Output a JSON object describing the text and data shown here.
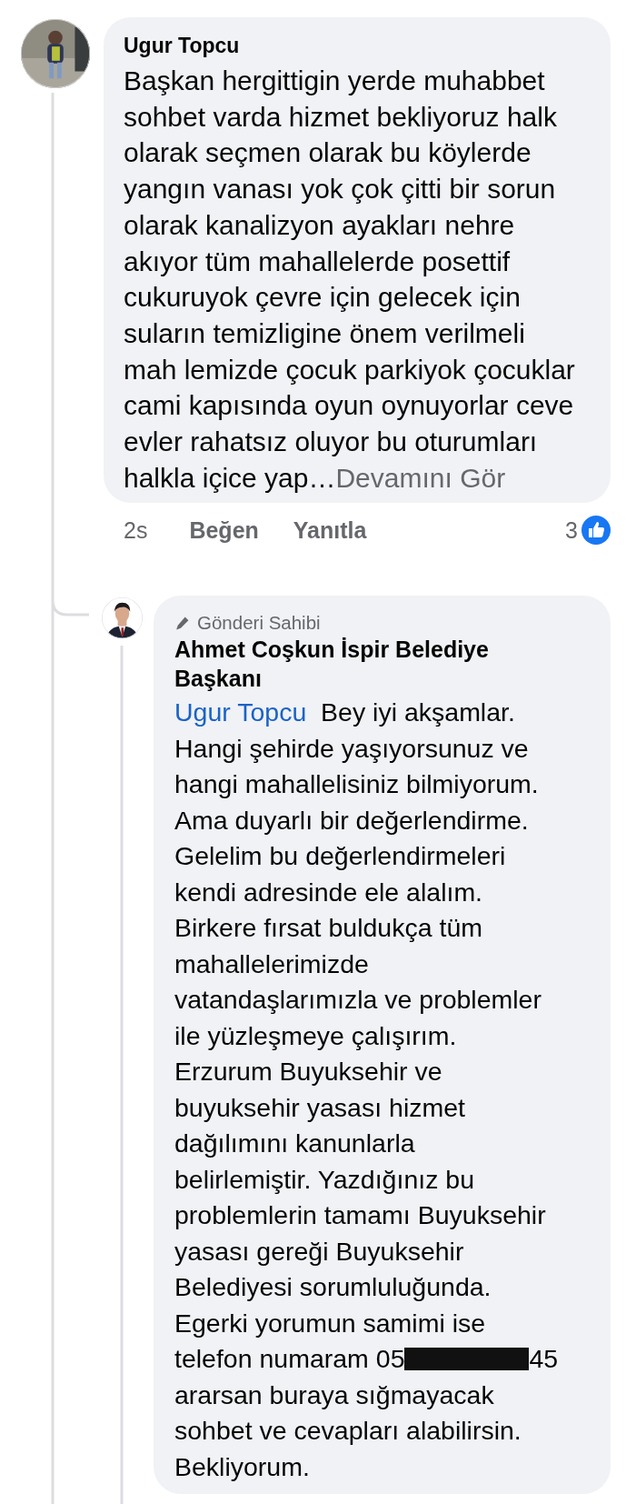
{
  "comment": {
    "author": "Ugur Topcu",
    "lines": [
      "Başkan hergittigin yerde muhabbet",
      "sohbet varda hizmet bekliyoruz halk",
      "olarak seçmen olarak bu köylerde",
      "yangın vanası yok çok çitti bir sorun",
      "olarak kanalizyon ayakları nehre",
      "akıyor tüm mahallelerde posettif",
      "cukuruyok çevre için gelecek için",
      "suların temizligine önem verilmeli",
      "mah lemizde çocuk parkiyok çocuklar",
      "cami kapısında oyun oynuyorlar ceve",
      "evler rahatsız oluyor bu oturumları",
      "halkla içice yap…"
    ],
    "see_more": "Devamını Gör",
    "time": "2s",
    "like_label": "Beğen",
    "reply_label": "Yanıtla",
    "reaction_count": "3"
  },
  "reply": {
    "badge": "Gönderi Sahibi",
    "author": "Ahmet Coşkun İspir Belediye Başkanı",
    "mention": "Ugur Topcu",
    "lines": [
      {
        "kind": "mention",
        "text": "Bey iyi akşamlar."
      },
      {
        "kind": "text",
        "text": "Hangi şehirde yaşıyorsunuz ve"
      },
      {
        "kind": "text",
        "text": "hangi mahallelisiniz bilmiyorum."
      },
      {
        "kind": "text",
        "text": "Ama duyarlı bir değerlendirme."
      },
      {
        "kind": "text",
        "text": "Gelelim bu değerlendirmeleri"
      },
      {
        "kind": "text",
        "text": "kendi adresinde ele alalım."
      },
      {
        "kind": "text",
        "text": "Birkere fırsat buldukça tüm"
      },
      {
        "kind": "text",
        "text": "mahallelerimizde"
      },
      {
        "kind": "text",
        "text": "vatandaşlarımızla ve problemler"
      },
      {
        "kind": "text",
        "text": "ile yüzleşmeye çalışırım."
      },
      {
        "kind": "text",
        "text": "Erzurum Buyuksehir ve"
      },
      {
        "kind": "text",
        "text": "buyuksehir yasası hizmet"
      },
      {
        "kind": "text",
        "text": "dağılımını kanunlarla"
      },
      {
        "kind": "text",
        "text": "belirlemiştir. Yazdığınız bu"
      },
      {
        "kind": "text",
        "text": "problemlerin tamamı Buyuksehir"
      },
      {
        "kind": "text",
        "text": "yasası gereği Buyuksehir"
      },
      {
        "kind": "text",
        "text": "Belediyesi sorumluluğunda."
      },
      {
        "kind": "text",
        "text": "Egerki yorumun samimi ise"
      },
      {
        "kind": "redacted",
        "text": "telefon numaram 05",
        "after": "45"
      },
      {
        "kind": "text",
        "text": "ararsan buraya sığmayacak"
      },
      {
        "kind": "text",
        "text": "sohbet ve cevapları alabilirsin."
      },
      {
        "kind": "text",
        "text": "Bekliyorum."
      }
    ]
  }
}
